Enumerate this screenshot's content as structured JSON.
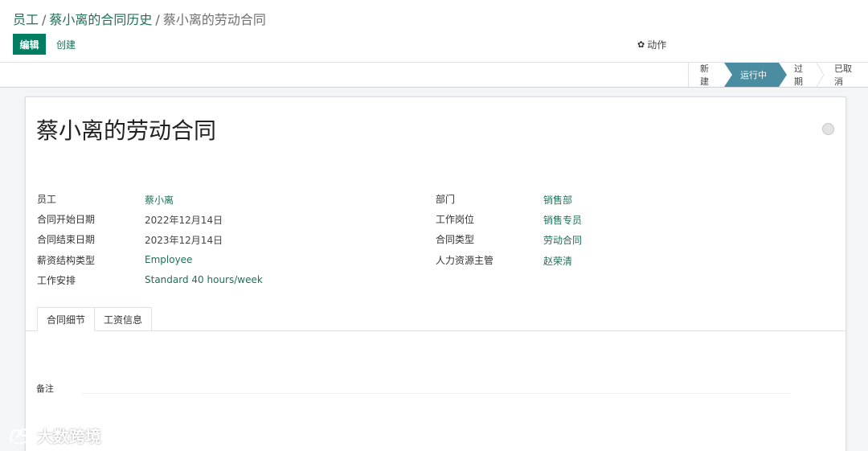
{
  "breadcrumb": {
    "items": [
      "员工",
      "蔡小离的合同历史"
    ],
    "separator": "/",
    "current": "蔡小离的劳动合同"
  },
  "toolbar": {
    "edit_label": "编辑",
    "create_label": "创建",
    "action_label": "动作",
    "action_icon": "gear-icon"
  },
  "statusbar": {
    "stages": [
      "新建",
      "运行中",
      "过期",
      "已取消"
    ],
    "active": "运行中",
    "active_color": "#4a8da1"
  },
  "form": {
    "title": "蔡小离的劳动合同",
    "left_fields": [
      {
        "label": "员工",
        "value": "蔡小离"
      },
      {
        "label": "合同开始日期",
        "value": "2022年12月14日"
      },
      {
        "label": "合同结束日期",
        "value": "2023年12月14日"
      },
      {
        "label": "薪资结构类型",
        "value": "Employee"
      },
      {
        "label": "工作安排",
        "value": "Standard 40 hours/week"
      }
    ],
    "right_fields": [
      {
        "label": "部门",
        "value": "销售部"
      },
      {
        "label": "工作岗位",
        "value": "销售专员"
      },
      {
        "label": "合同类型",
        "value": "劳动合同"
      },
      {
        "label": "人力资源主管",
        "value": "赵荣清"
      }
    ],
    "tabs": [
      "合同细节",
      "工资信息"
    ],
    "notes_label": "备注"
  },
  "watermark": {
    "text": "大数跨境"
  },
  "colors": {
    "primary": "#017e61",
    "link": "#1f6f5a",
    "status_active": "#4a8da1"
  }
}
